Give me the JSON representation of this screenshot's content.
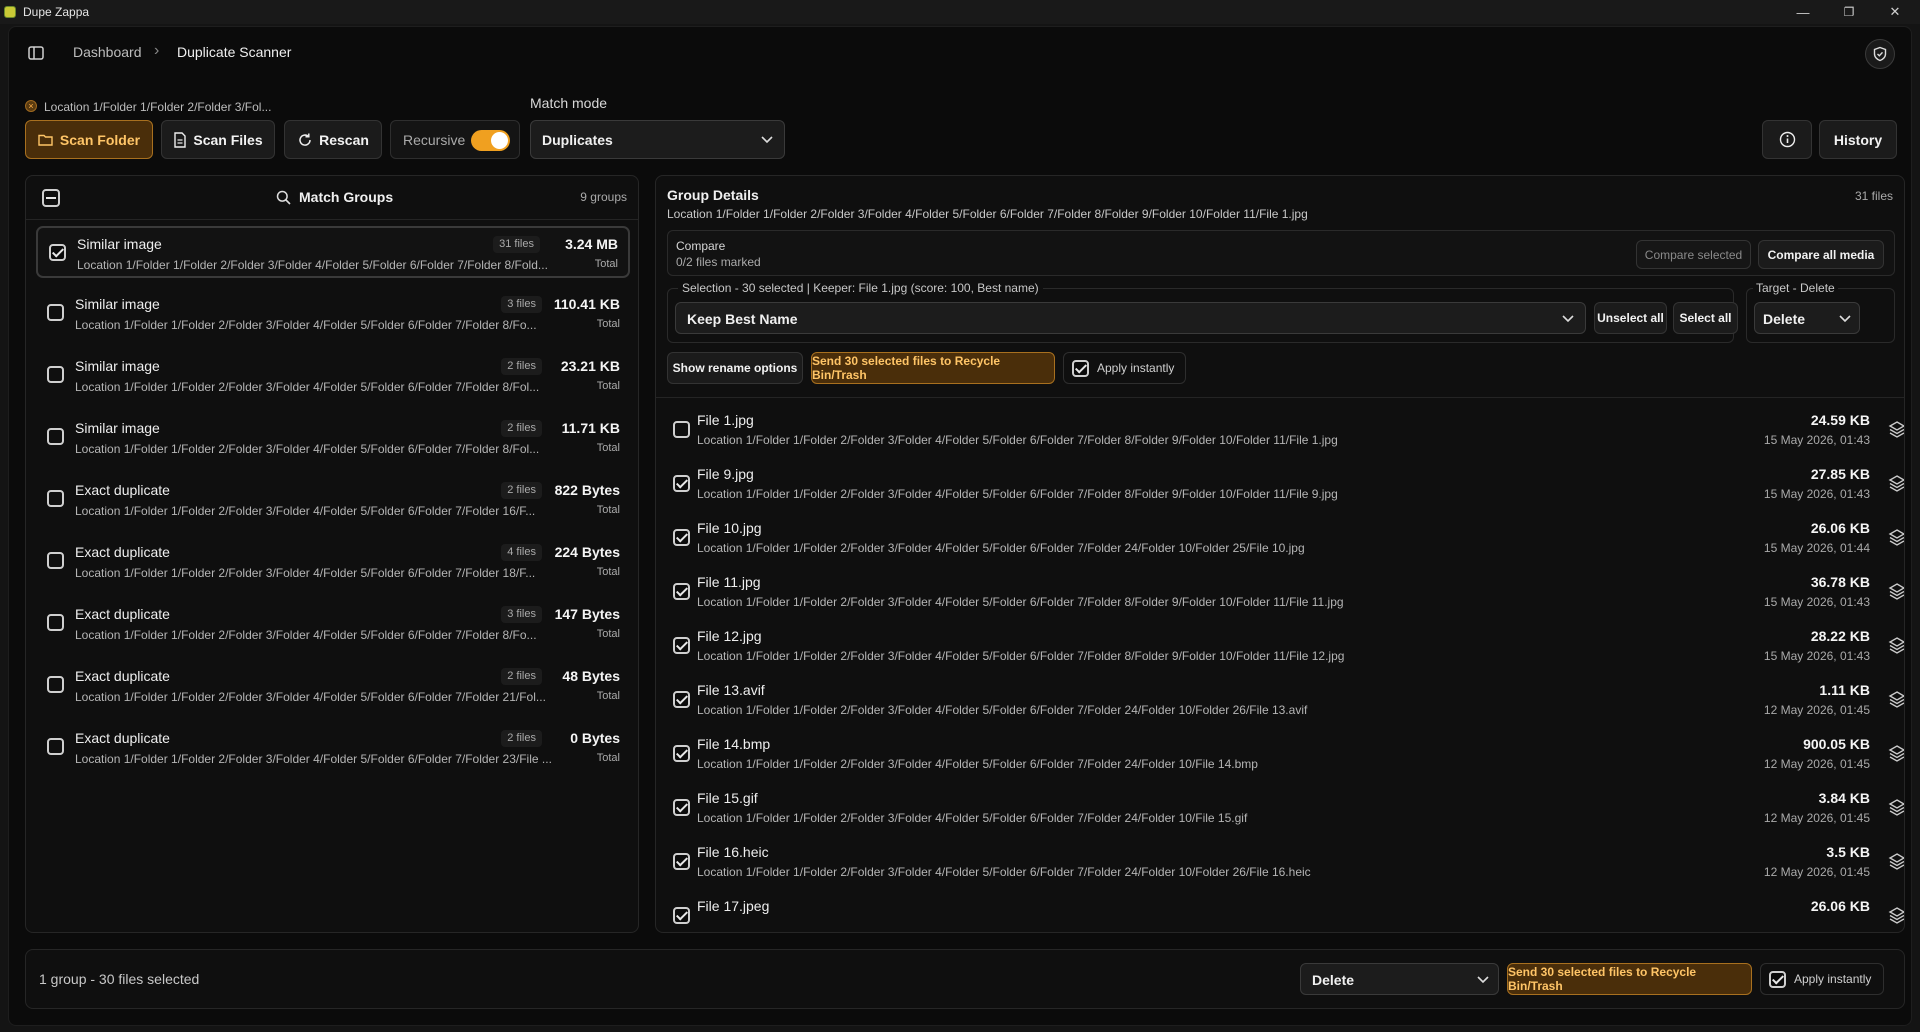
{
  "window": {
    "title": "Dupe Zappa",
    "minimize": "—",
    "restore": "❐",
    "close": "✕"
  },
  "header": {
    "breadcrumb_1": "Dashboard",
    "separator": "›",
    "breadcrumb_2": "Duplicate Scanner"
  },
  "location_chip": "Location 1/Folder 1/Folder 2/Folder 3/Fol...",
  "toolbar": {
    "scan_folder": "Scan Folder",
    "scan_files": "Scan Files",
    "rescan": "Rescan",
    "recursive": "Recursive",
    "recursive_on": true,
    "match_mode_label": "Match mode",
    "match_mode_value": "Duplicates",
    "history": "History"
  },
  "left": {
    "title": "Match Groups",
    "count": "9 groups",
    "groups": [
      {
        "title": "Similar image",
        "count": "31 files",
        "size": "3.24 MB",
        "total": "Total",
        "path": "Location 1/Folder 1/Folder 2/Folder 3/Folder 4/Folder 5/Folder 6/Folder 7/Folder 8/Fold...",
        "checked": true
      },
      {
        "title": "Similar image",
        "count": "3 files",
        "size": "110.41 KB",
        "total": "Total",
        "path": "Location 1/Folder 1/Folder 2/Folder 3/Folder 4/Folder 5/Folder 6/Folder 7/Folder 8/Fo...",
        "checked": false
      },
      {
        "title": "Similar image",
        "count": "2 files",
        "size": "23.21 KB",
        "total": "Total",
        "path": "Location 1/Folder 1/Folder 2/Folder 3/Folder 4/Folder 5/Folder 6/Folder 7/Folder 8/Fol...",
        "checked": false
      },
      {
        "title": "Similar image",
        "count": "2 files",
        "size": "11.71 KB",
        "total": "Total",
        "path": "Location 1/Folder 1/Folder 2/Folder 3/Folder 4/Folder 5/Folder 6/Folder 7/Folder 8/Fol...",
        "checked": false
      },
      {
        "title": "Exact duplicate",
        "count": "2 files",
        "size": "822 Bytes",
        "total": "Total",
        "path": "Location 1/Folder 1/Folder 2/Folder 3/Folder 4/Folder 5/Folder 6/Folder 7/Folder 16/F...",
        "checked": false
      },
      {
        "title": "Exact duplicate",
        "count": "4 files",
        "size": "224 Bytes",
        "total": "Total",
        "path": "Location 1/Folder 1/Folder 2/Folder 3/Folder 4/Folder 5/Folder 6/Folder 7/Folder 18/F...",
        "checked": false
      },
      {
        "title": "Exact duplicate",
        "count": "3 files",
        "size": "147 Bytes",
        "total": "Total",
        "path": "Location 1/Folder 1/Folder 2/Folder 3/Folder 4/Folder 5/Folder 6/Folder 7/Folder 8/Fo...",
        "checked": false
      },
      {
        "title": "Exact duplicate",
        "count": "2 files",
        "size": "48 Bytes",
        "total": "Total",
        "path": "Location 1/Folder 1/Folder 2/Folder 3/Folder 4/Folder 5/Folder 6/Folder 7/Folder 21/Fol...",
        "checked": false
      },
      {
        "title": "Exact duplicate",
        "count": "2 files",
        "size": "0 Bytes",
        "total": "Total",
        "path": "Location 1/Folder 1/Folder 2/Folder 3/Folder 4/Folder 5/Folder 6/Folder 7/Folder 23/File ...",
        "checked": false
      }
    ]
  },
  "right": {
    "title": "Group Details",
    "count": "31 files",
    "path": "Location 1/Folder 1/Folder 2/Folder 3/Folder 4/Folder 5/Folder 6/Folder 7/Folder 8/Folder 9/Folder 10/Folder 11/File 1.jpg",
    "compare": {
      "label": "Compare",
      "marked": "0/2 files marked",
      "compare_selected": "Compare selected",
      "compare_all": "Compare all media"
    },
    "selection": {
      "label": "Selection - 30 selected | Keeper: File 1.jpg (score: 100, Best name)",
      "strategy": "Keep Best Name",
      "unselect_all": "Unselect all",
      "select_all": "Select all",
      "target_label": "Target - Delete",
      "target_value": "Delete"
    },
    "actions": {
      "rename": "Show rename options",
      "send": "Send 30 selected files to Recycle Bin/Trash",
      "apply": "Apply instantly"
    },
    "files": [
      {
        "name": "File 1.jpg",
        "path": "Location 1/Folder 1/Folder 2/Folder 3/Folder 4/Folder 5/Folder 6/Folder 7/Folder 8/Folder 9/Folder 10/Folder 11/File 1.jpg",
        "size": "24.59 KB",
        "date": "15 May 2026, 01:43",
        "checked": false
      },
      {
        "name": "File 9.jpg",
        "path": "Location 1/Folder 1/Folder 2/Folder 3/Folder 4/Folder 5/Folder 6/Folder 7/Folder 8/Folder 9/Folder 10/Folder 11/File 9.jpg",
        "size": "27.85 KB",
        "date": "15 May 2026, 01:43",
        "checked": true
      },
      {
        "name": "File 10.jpg",
        "path": "Location 1/Folder 1/Folder 2/Folder 3/Folder 4/Folder 5/Folder 6/Folder 7/Folder 24/Folder 10/Folder 25/File 10.jpg",
        "size": "26.06 KB",
        "date": "15 May 2026, 01:44",
        "checked": true
      },
      {
        "name": "File 11.jpg",
        "path": "Location 1/Folder 1/Folder 2/Folder 3/Folder 4/Folder 5/Folder 6/Folder 7/Folder 8/Folder 9/Folder 10/Folder 11/File 11.jpg",
        "size": "36.78 KB",
        "date": "15 May 2026, 01:43",
        "checked": true
      },
      {
        "name": "File 12.jpg",
        "path": "Location 1/Folder 1/Folder 2/Folder 3/Folder 4/Folder 5/Folder 6/Folder 7/Folder 8/Folder 9/Folder 10/Folder 11/File 12.jpg",
        "size": "28.22 KB",
        "date": "15 May 2026, 01:43",
        "checked": true
      },
      {
        "name": "File 13.avif",
        "path": "Location 1/Folder 1/Folder 2/Folder 3/Folder 4/Folder 5/Folder 6/Folder 7/Folder 24/Folder 10/Folder 26/File 13.avif",
        "size": "1.11 KB",
        "date": "12 May 2026, 01:45",
        "checked": true
      },
      {
        "name": "File 14.bmp",
        "path": "Location 1/Folder 1/Folder 2/Folder 3/Folder 4/Folder 5/Folder 6/Folder 7/Folder 24/Folder 10/File 14.bmp",
        "size": "900.05 KB",
        "date": "12 May 2026, 01:45",
        "checked": true
      },
      {
        "name": "File 15.gif",
        "path": "Location 1/Folder 1/Folder 2/Folder 3/Folder 4/Folder 5/Folder 6/Folder 7/Folder 24/Folder 10/File 15.gif",
        "size": "3.84 KB",
        "date": "12 May 2026, 01:45",
        "checked": true
      },
      {
        "name": "File 16.heic",
        "path": "Location 1/Folder 1/Folder 2/Folder 3/Folder 4/Folder 5/Folder 6/Folder 7/Folder 24/Folder 10/Folder 26/File 16.heic",
        "size": "3.5 KB",
        "date": "12 May 2026, 01:45",
        "checked": true
      },
      {
        "name": "File 17.jpeg",
        "path": "",
        "size": "26.06 KB",
        "date": "",
        "checked": true
      }
    ]
  },
  "footer": {
    "status": "1 group - 30 files selected",
    "target": "Delete",
    "send": "Send 30 selected files to Recycle Bin/Trash",
    "apply": "Apply instantly"
  },
  "colors": {
    "accent": "#f0a020",
    "accent_bg": "#4a2e0a",
    "accent_text": "#ffc567",
    "bg": "#0b0b0b"
  }
}
